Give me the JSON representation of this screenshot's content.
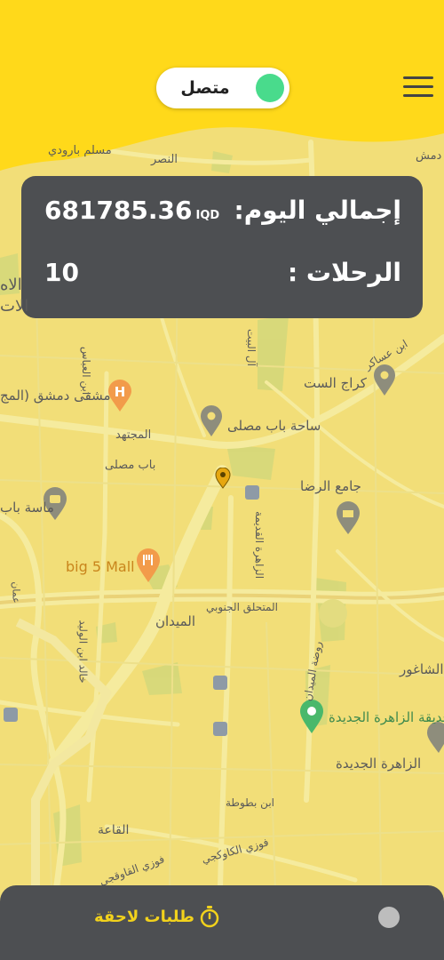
{
  "status": {
    "label": "متصل",
    "online": true,
    "accent": "#49db8c"
  },
  "header": {
    "color": "#ffd91a"
  },
  "stats": {
    "today_total_label": "إجمالي اليوم:",
    "today_total_value": "681785.36",
    "currency": "IQD",
    "trips_label": "الرحلات :",
    "trips_value": "10"
  },
  "map": {
    "labels": {
      "muslim_barudi": "مسلم بارودي",
      "nasr": "النصر",
      "damascus_hospital": "مشفى دمشق (المج",
      "mujtahid": "المجتهد",
      "bab_musalla_square": "ساحة باب مصلى",
      "bab_musalla": "باب مصلى",
      "karaj_alsit": "كراج الست",
      "ibn_asakir": "ابن عساكر",
      "al_rida_mosque": "جامع الرضا",
      "masa_bab": "ماسة باب",
      "big5": "big 5 Mall",
      "south_bypass": "المتحلق الجنوبي",
      "midan": "الميدان",
      "zahira_old": "الزاهرة القديمة",
      "al_bayt": "آل البيت",
      "ibn_abbas": "ابن العباس",
      "khalid": "خالد ابن الوليد",
      "rawdat_midan": "روضة الميدان",
      "shaghour": "الشاغور",
      "zahira_new_park": "حديقة الزاهرة الجديدة",
      "zahira_new": "الزاهرة الجديدة",
      "ibn_battuta": "ابن بطوطة",
      "qaa": "القاعة",
      "fawzi_kawukji": "فوزي الكاوكجي",
      "fawzi_qawuqji": "فوزي القاوقجي",
      "dams": "دمش",
      "ilah": "الاه",
      "lat": "الات",
      "oman": "عمان"
    }
  },
  "bottom": {
    "later_requests_label": "طلبات لاحقة",
    "accent": "#f2d21c"
  }
}
